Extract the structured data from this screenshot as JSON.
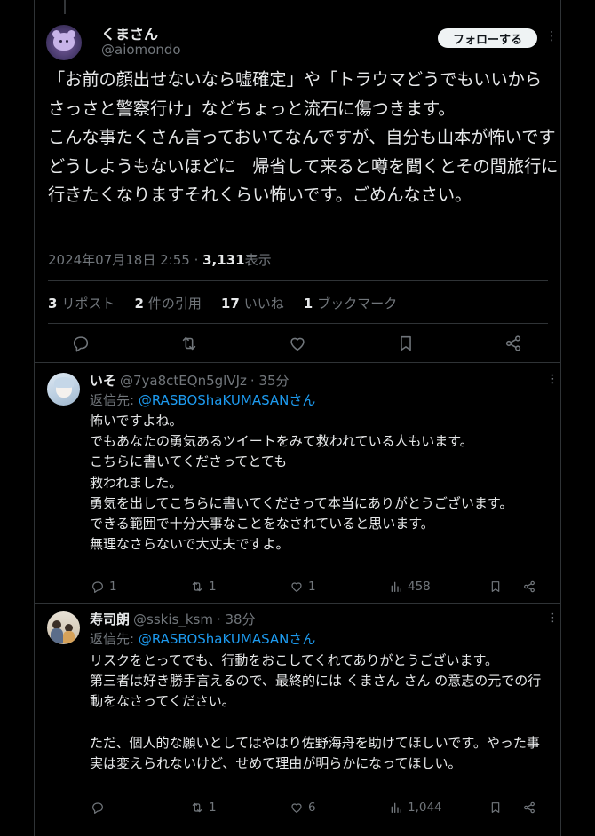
{
  "main": {
    "author_name": "くまさん",
    "author_handle": "@aiomondo",
    "follow_label": "フォローする",
    "more_icon": "more-icon",
    "text": "「お前の顔出せないなら嘘確定」や「トラウマどうでもいいからさっさと警察行け」などちょっと流石に傷つきます。\nこんな事たくさん言っておいてなんですが、自分も山本が怖いですどうしようもないほどに　帰省して来ると噂を聞くとその間旅行に行きたくなりますそれくらい怖いです。ごめんなさい。",
    "timestamp": "2024年07月18日 2:55",
    "separator": " · ",
    "views_count": "3,131",
    "views_label": "表示",
    "stats": [
      {
        "count": "3",
        "label": "リポスト"
      },
      {
        "count": "2",
        "label": "件の引用"
      },
      {
        "count": "17",
        "label": "いいね"
      },
      {
        "count": "1",
        "label": "ブックマーク"
      }
    ],
    "action_icons": [
      "reply-icon",
      "retweet-icon",
      "like-icon",
      "bookmark-icon",
      "share-icon"
    ]
  },
  "replies": [
    {
      "name": "いそ",
      "handle": "@7ya8ctEQn5glVJz",
      "time": "· 35分",
      "reply_prefix": "返信先: ",
      "reply_mention": "@RASBOShaKUMASANさん",
      "text": "怖いですよね。\nでもあなたの勇気あるツイートをみて救われている人もいます。\nこちらに書いてくださってとても\n救われました。\n勇気を出してこちらに書いてくださって本当にありがとうございます。\nできる範囲で十分大事なことをなされていると思います。\n無理なさらないで大丈夫ですよ。",
      "replies": "1",
      "retweets": "1",
      "likes": "1",
      "views": "458"
    },
    {
      "name": "寿司朗",
      "handle": "@sskis_ksm",
      "time": "· 38分",
      "reply_prefix": "返信先: ",
      "reply_mention": "@RASBOShaKUMASANさん",
      "text": "リスクをとってでも、行動をおこしてくれてありがとうございます。\n第三者は好き勝手言えるので、最終的には くまさん さん の意志の元での行動をなさってください。\n\nただ、個人的な願いとしてはやはり佐野海舟を助けてほしいです。やった事実は変えられないけど、せめて理由が明らかになってほしい。",
      "replies": "",
      "retweets": "1",
      "likes": "6",
      "views": "1,044"
    }
  ],
  "colors": {
    "background": "#000000",
    "text": "#e7e9ea",
    "muted": "#71767b",
    "accent": "#1d9bf0",
    "border": "#2f3336"
  }
}
